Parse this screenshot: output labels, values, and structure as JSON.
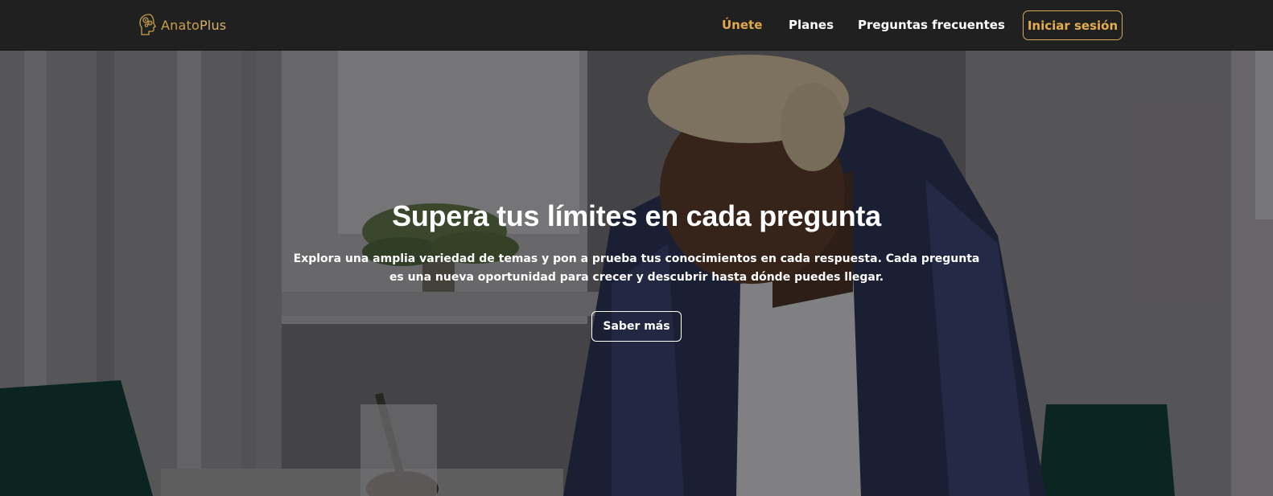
{
  "colors": {
    "nav_background": "#202020",
    "accent_gold": "#e0a94a",
    "brand_gold": "#c9a04a",
    "text_white": "#ffffff"
  },
  "brand": {
    "icon": "head-gears-icon",
    "name_part1": "Anato",
    "name_part2": "Plus"
  },
  "nav": {
    "links": [
      {
        "label": "Únete",
        "active": true
      },
      {
        "label": "Planes",
        "active": false
      },
      {
        "label": "Preguntas frecuentes",
        "active": false
      }
    ],
    "login_label": "Iniciar sesión"
  },
  "hero": {
    "title": "Supera tus límites en cada pregunta",
    "subtitle": "Explora una amplia variedad de temas y pon a prueba tus conocimientos en cada respuesta. Cada pregunta es una nueva oportunidad para crecer y descubrir hasta dónde puedes llegar.",
    "cta_label": "Saber más"
  }
}
